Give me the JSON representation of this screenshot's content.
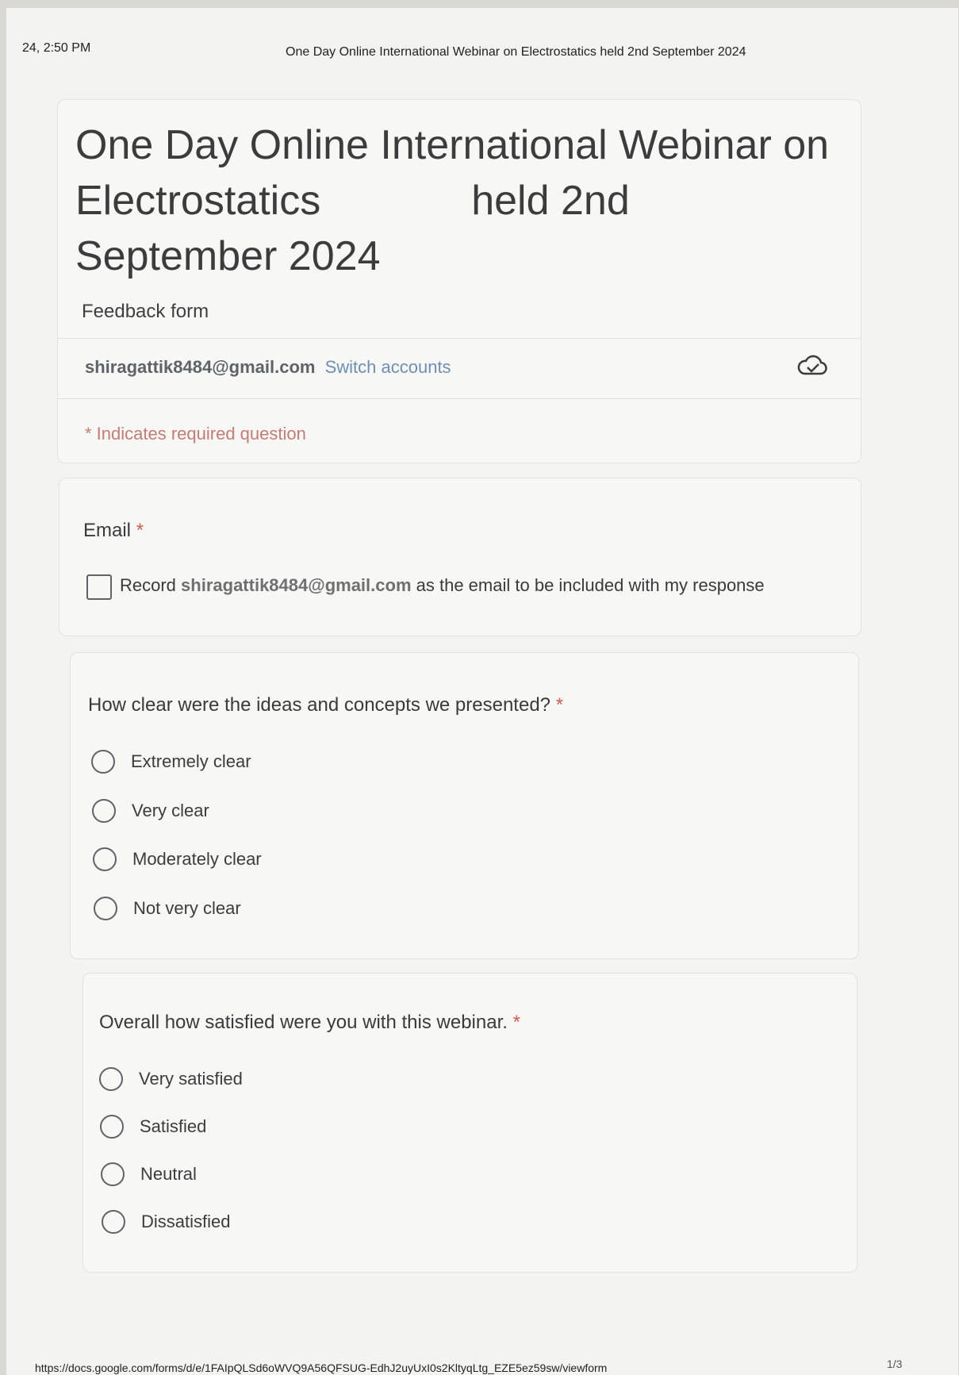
{
  "print_header": {
    "time": "24, 2:50 PM",
    "doc_title": "One Day Online International Webinar on Electrostatics held 2nd September 2024"
  },
  "form": {
    "title_line1": "One Day Online International Webinar on",
    "title_line2a": "Electrostatics",
    "title_line2b": "held 2nd",
    "title_line3": "September 2024",
    "description": "Feedback form"
  },
  "account": {
    "email": "shiragattik8484@gmail.com",
    "switch_label": "Switch accounts",
    "cloud_icon": "cloud-check-icon"
  },
  "required_note": "* Indicates required question",
  "questions": {
    "email": {
      "label": "Email",
      "star": "*",
      "record_prefix": "Record",
      "record_email": "shiragattik8484@gmail.com",
      "record_suffix": "as the email to be included with my response"
    },
    "clarity": {
      "label": "How clear were the ideas and concepts we presented?",
      "star": "*",
      "options": [
        "Extremely clear",
        "Very clear",
        "Moderately clear",
        "Not very clear"
      ]
    },
    "satisfaction": {
      "label": "Overall how satisfied were you with this webinar.",
      "star": "*",
      "options": [
        "Very satisfied",
        "Satisfied",
        "Neutral",
        "Dissatisfied"
      ]
    }
  },
  "footer": {
    "url": "https://docs.google.com/forms/d/e/1FAIpQLSd6oWVQ9A56QFSUG-EdhJ2uyUxI0s2KltyqLtg_EZE5ez59sw/viewform",
    "page": "1/3"
  },
  "colors": {
    "required_star": "#d25a4f",
    "link": "#6d8fb3"
  }
}
